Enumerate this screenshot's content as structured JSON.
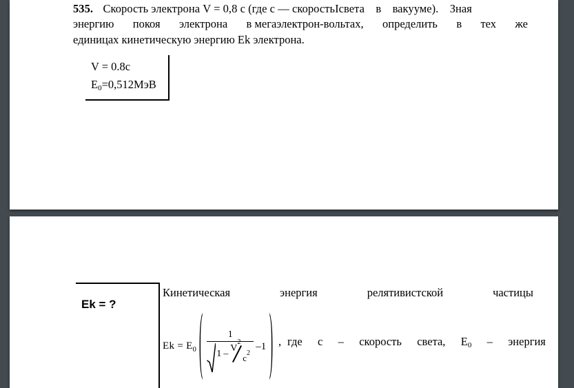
{
  "background_color": "#434a50",
  "panel_color": "#ffffff",
  "panel_1": {
    "problem": {
      "number": "535.",
      "line_1_a": "Скорость электрона V = 0,8 с   (где с —",
      "line_1_b": "скоростьIсвета",
      "line_1_c": "в",
      "line_1_d": "вакууме).",
      "line_1_e": "Зная",
      "line_2": [
        "энергию",
        "покоя",
        "электрона",
        "в мегаэлектрон-вольтах,",
        "определить",
        "в",
        "тех",
        "же"
      ],
      "line_3": "единицах кинетическую энергию Ek электрона."
    },
    "given_box": {
      "row_1": "V = 0.8c",
      "row_2_label": "E",
      "row_2_sub": "0",
      "row_2_value": "=0,512МэВ"
    }
  },
  "panel_2": {
    "find_box": {
      "label": "Ek = ?"
    },
    "solution": {
      "heading_words": [
        "Кинетическая",
        "энергия",
        "релятивистской",
        "частицы"
      ],
      "formula": {
        "lhs": "Ek",
        "equals": "=",
        "rhs_base": "E",
        "rhs_sub": "0",
        "paren_open": "(",
        "numerator": "1",
        "radicand_one": "1",
        "radicand_minus": "–",
        "radicand_v": "V",
        "radicand_v_exp": "2",
        "radicand_c": "c",
        "radicand_c_exp": "2",
        "minus_one": "–1",
        "paren_close": ")",
        "comma": ","
      },
      "tail_words": [
        "где",
        "с",
        "–",
        "скорость",
        "света,",
        "E",
        "–",
        "энергия"
      ],
      "tail_text_1": "где  с  –  скорость  света,",
      "tail_e": "E",
      "tail_e_sub": "0",
      "tail_text_2": "–  энергия"
    }
  }
}
